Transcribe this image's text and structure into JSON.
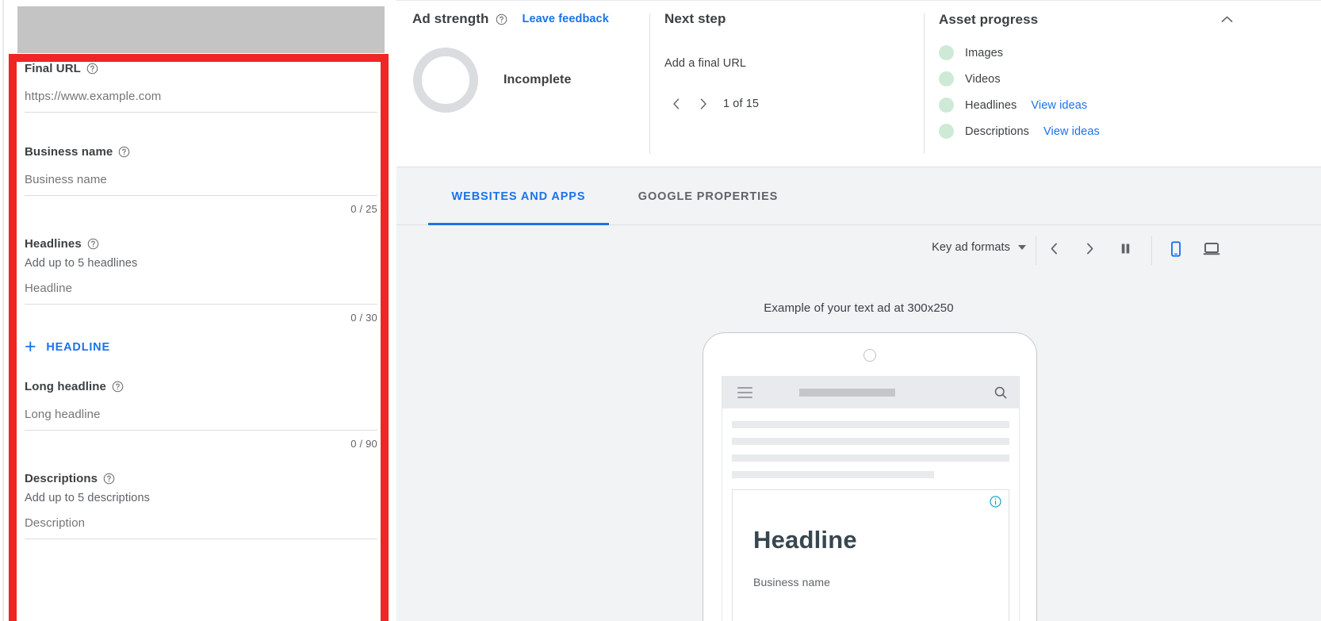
{
  "left_panel": {
    "fields": [
      {
        "label": "Final URL",
        "help_icon": "help-circle-icon",
        "placeholder": "https://www.example.com",
        "value": ""
      },
      {
        "label": "Business name",
        "help_icon": "help-circle-icon",
        "placeholder": "Business name",
        "value": "",
        "counter": "0 / 25"
      },
      {
        "label": "Headlines",
        "help_icon": "help-circle-icon",
        "sub_label": "Add up to 5 headlines",
        "placeholder": "Headline",
        "value": "",
        "counter": "0 / 30",
        "add_button": "HEADLINE",
        "add_icon": "plus-icon"
      },
      {
        "label": "Long headline",
        "help_icon": "help-circle-icon",
        "placeholder": "Long headline",
        "value": "",
        "counter": "0 / 90"
      },
      {
        "label": "Descriptions",
        "help_icon": "help-circle-icon",
        "sub_label": "Add up to 5 descriptions",
        "placeholder": "Description",
        "value": ""
      }
    ]
  },
  "ad_strength": {
    "title": "Ad strength",
    "help_icon": "help-circle-icon",
    "feedback_link": "Leave feedback",
    "status": "Incomplete",
    "ring_color": "#dadce0"
  },
  "next_step": {
    "title": "Next step",
    "text": "Add a final URL",
    "prev_icon": "chevron-left-icon",
    "next_icon": "chevron-right-icon",
    "counter": "1 of 15"
  },
  "asset_progress": {
    "title": "Asset progress",
    "collapse_icon": "chevron-up-icon",
    "dot_color": "#ceead6",
    "items": [
      {
        "name": "Images",
        "link": ""
      },
      {
        "name": "Videos",
        "link": ""
      },
      {
        "name": "Headlines",
        "link": "View ideas"
      },
      {
        "name": "Descriptions",
        "link": "View ideas"
      }
    ]
  },
  "tabs": [
    {
      "label": "WEBSITES AND APPS",
      "active": true
    },
    {
      "label": "GOOGLE PROPERTIES",
      "active": false
    }
  ],
  "preview_toolbar": {
    "format_select": "Key ad formats",
    "caret_icon": "chevron-down-icon",
    "prev_icon": "chevron-left-icon",
    "next_icon": "chevron-right-icon",
    "pause_icon": "pause-icon",
    "mobile_icon": "mobile-device-icon",
    "desktop_icon": "desktop-device-icon",
    "mobile_selected": true,
    "accent_color": "#1a73e8"
  },
  "preview": {
    "caption": "Example of your text ad at 300x250",
    "device_icon": "phone-frame",
    "menu_icon": "hamburger-menu-icon",
    "search_icon": "search-icon",
    "info_icon": "info-circle-icon",
    "ad_headline": "Headline",
    "ad_business_name": "Business name"
  },
  "annotation": {
    "highlight_color": "#ee2624"
  }
}
